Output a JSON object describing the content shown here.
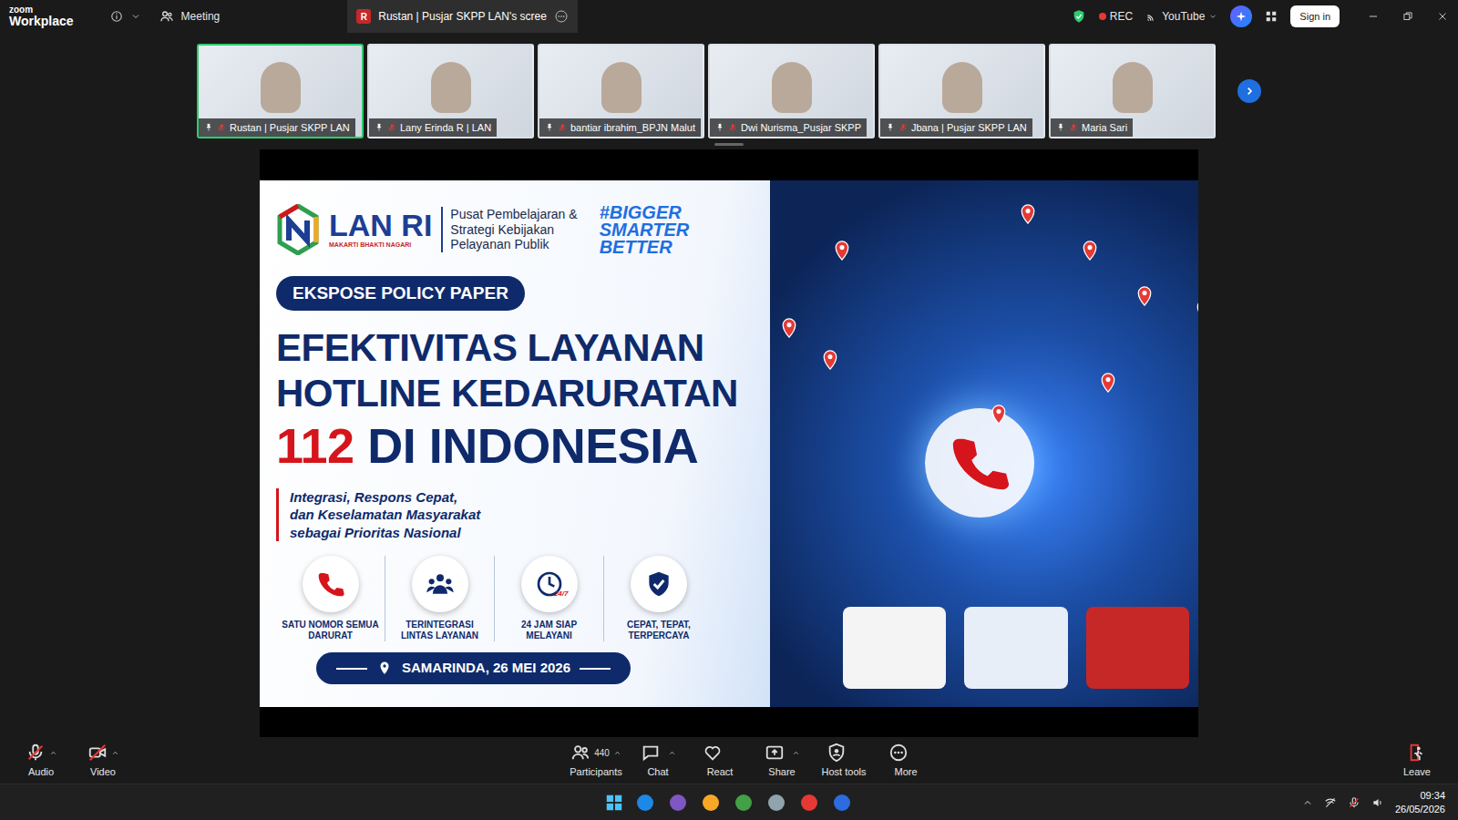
{
  "app": {
    "brand": "zoom",
    "product": "Workplace"
  },
  "top_bar": {
    "meeting": "Meeting",
    "share_tab": {
      "avatar": "R",
      "label": "Rustan | Pusjar SKPP LAN's scree"
    },
    "rec": "REC",
    "stream": "YouTube",
    "sign_in": "Sign in"
  },
  "participants": [
    {
      "name": "Rustan | Pusjar SKPP LAN",
      "selected": true,
      "pinned": true,
      "muted": false
    },
    {
      "name": "Lany Erinda R | LAN",
      "selected": false,
      "pinned": true,
      "muted": true
    },
    {
      "name": "bantiar ibrahim_BPJN Malut",
      "selected": false,
      "pinned": false,
      "muted": true
    },
    {
      "name": "Dwi Nurisma_Pusjar SKPP",
      "selected": false,
      "pinned": false,
      "muted": true
    },
    {
      "name": "Jbana | Pusjar SKPP LAN",
      "selected": false,
      "pinned": false,
      "muted": true
    },
    {
      "name": "Maria Sari",
      "selected": false,
      "pinned": false,
      "muted": true
    }
  ],
  "banner": {
    "org": {
      "name": "LAN RI",
      "motto": "MAKARTI BHAKTI NAGARI",
      "unit": [
        "Pusat Pembelajaran &",
        "Strategi Kebijakan",
        "Pelayanan Publik"
      ]
    },
    "hashtag": [
      "#BIGGER",
      "SMARTER",
      "BETTER"
    ],
    "tag": "EKSPOSE POLICY PAPER",
    "title": [
      "EFEKTIVITAS LAYANAN",
      "HOTLINE KEDARURATAN"
    ],
    "title_number": "112",
    "title_tail": "DI INDONESIA",
    "subtitle": [
      "Integrasi, Respons Cepat,",
      "dan Keselamatan Masyarakat",
      "sebagai Prioritas Nasional"
    ],
    "features": [
      {
        "label": "SATU NOMOR SEMUA DARURAT",
        "kind": "phone",
        "icon_text": ""
      },
      {
        "label": "TERINTEGRASI LINTAS LAYANAN",
        "kind": "people",
        "icon_text": ""
      },
      {
        "label": "24 JAM SIAP MELAYANI",
        "kind": "clock",
        "icon_text": "24/7"
      },
      {
        "label": "CEPAT, TEPAT, TERPERCAYA",
        "kind": "shield",
        "icon_text": ""
      }
    ],
    "place_date": "SAMARINDA, 26 MEI 2026"
  },
  "toolbar": {
    "left": [
      {
        "label": "Audio",
        "kind": "audio",
        "off": true,
        "caret": true
      },
      {
        "label": "Video",
        "kind": "video",
        "off": true,
        "caret": true
      }
    ],
    "center": [
      {
        "label": "Participants",
        "kind": "participants",
        "count": "440",
        "caret": true
      },
      {
        "label": "Chat",
        "kind": "chat",
        "count": "",
        "caret": true
      },
      {
        "label": "React",
        "kind": "react",
        "count": "",
        "caret": false
      },
      {
        "label": "Share",
        "kind": "share",
        "count": "",
        "caret": true
      },
      {
        "label": "Host tools",
        "kind": "host",
        "count": "",
        "caret": false
      },
      {
        "label": "More",
        "kind": "more",
        "count": "",
        "caret": false
      }
    ],
    "leave": "Leave"
  },
  "taskbar": {
    "time": "09:34",
    "date": "26/05/2026"
  }
}
